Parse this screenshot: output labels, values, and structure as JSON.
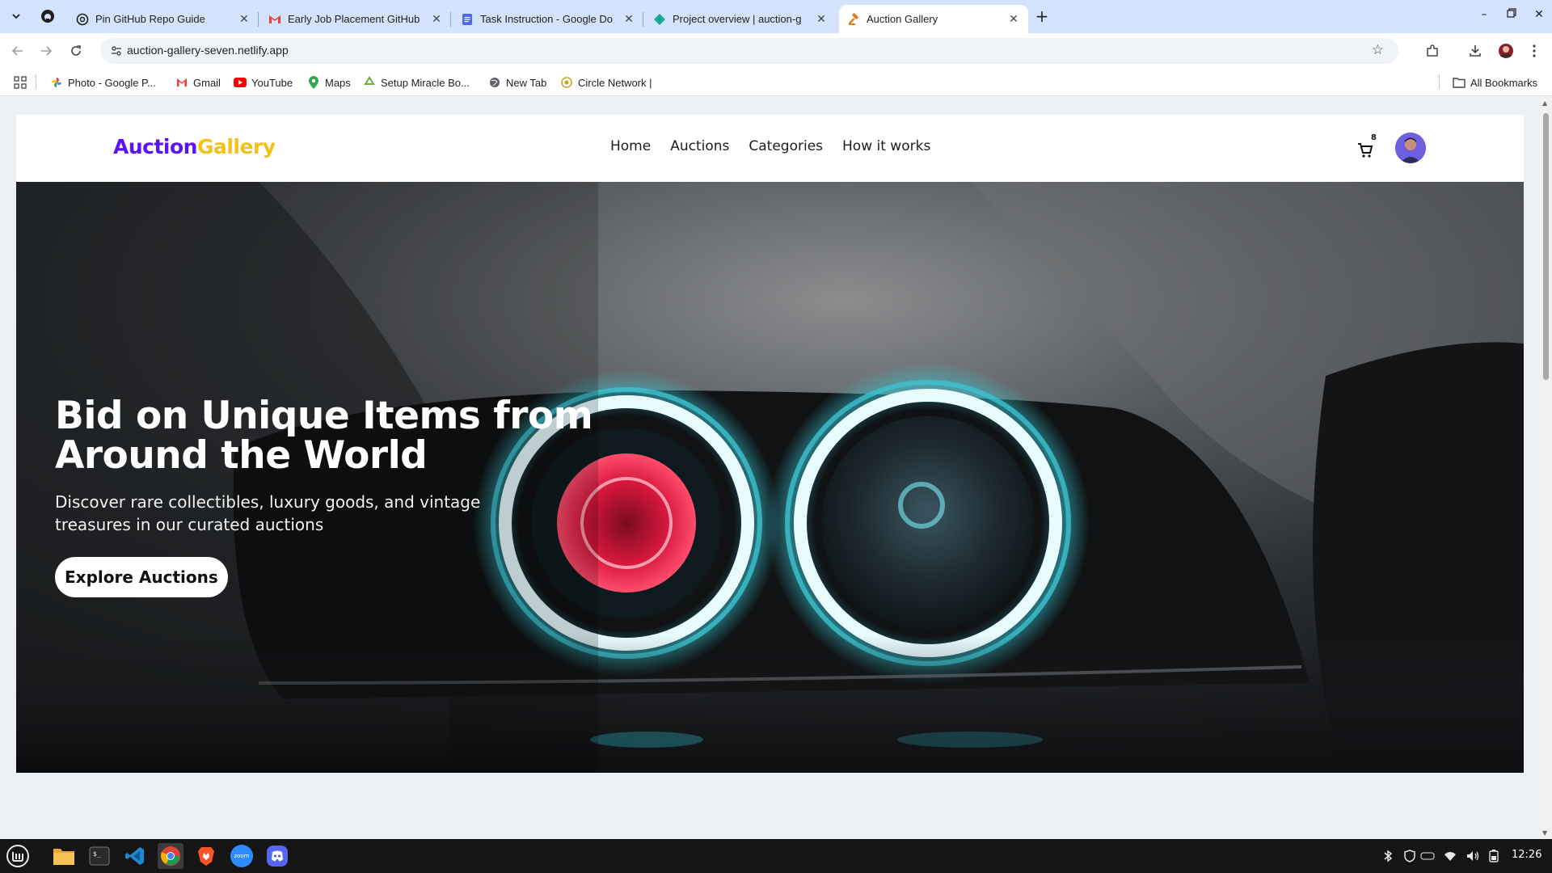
{
  "browser": {
    "tabs": [
      {
        "title": "Pin GitHub Repo Guide",
        "icon": "chatgpt-icon"
      },
      {
        "title": "Early Job Placement GitHub",
        "icon": "gmail-icon"
      },
      {
        "title": "Task Instruction - Google Do",
        "icon": "google-docs-icon"
      },
      {
        "title": "Project overview | auction-g",
        "icon": "netlify-icon"
      },
      {
        "title": "Auction Gallery",
        "icon": "gavel-icon",
        "active": true
      }
    ],
    "url": "auction-gallery-seven.netlify.app",
    "bookmarks": [
      {
        "label": "Photo - Google P...",
        "icon": "google-photos-icon"
      },
      {
        "label": "Gmail",
        "icon": "gmail-icon"
      },
      {
        "label": "YouTube",
        "icon": "youtube-icon"
      },
      {
        "label": "Maps",
        "icon": "maps-icon"
      },
      {
        "label": "Setup Miracle Bo...",
        "icon": "recycle-icon"
      },
      {
        "label": "New Tab",
        "icon": "globe-icon"
      },
      {
        "label": "Circle Network |",
        "icon": "circle-network-icon"
      }
    ],
    "all_bookmarks": "All Bookmarks"
  },
  "site": {
    "logo_part1": "Auction",
    "logo_part2": "Gallery",
    "nav": [
      "Home",
      "Auctions",
      "Categories",
      "How it works"
    ],
    "cart_count": "8",
    "hero": {
      "title": "Bid on Unique Items from Around the World",
      "subtitle": "Discover rare collectibles, luxury goods, and vintage treasures in our curated auctions",
      "cta": "Explore Auctions"
    },
    "colors": {
      "logo_primary": "#5b12f6",
      "logo_accent": "#f2c21b"
    }
  },
  "taskbar": {
    "apps": [
      "files-icon",
      "terminal-icon",
      "vscode-icon",
      "chrome-icon",
      "brave-icon",
      "zoom-icon",
      "discord-icon"
    ],
    "zoom_label": "zoom",
    "clock": "12:26"
  }
}
